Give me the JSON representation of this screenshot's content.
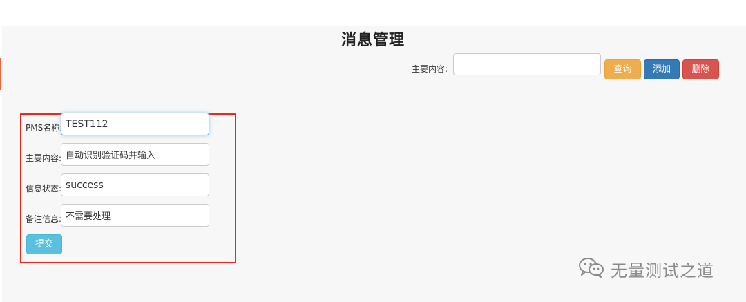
{
  "page": {
    "title": "消息管理"
  },
  "search": {
    "label": "主要内容:",
    "value": "",
    "query_label": "查询",
    "add_label": "添加",
    "delete_label": "删除"
  },
  "form": {
    "fields": [
      {
        "label": "PMS名称:",
        "value": "TEST112"
      },
      {
        "label": "主要内容:",
        "value": "自动识别验证码并输入"
      },
      {
        "label": "信息状态:",
        "value": "success"
      },
      {
        "label": "备注信息:",
        "value": "不需要处理"
      }
    ],
    "submit_label": "提交"
  },
  "watermark": {
    "text": "无量测试之道",
    "icon": "wechat-icon"
  },
  "colors": {
    "query": "#f0ad4e",
    "add": "#337ab7",
    "delete": "#d9534f",
    "submit": "#5bc0de",
    "highlight_border": "#e8291c"
  }
}
